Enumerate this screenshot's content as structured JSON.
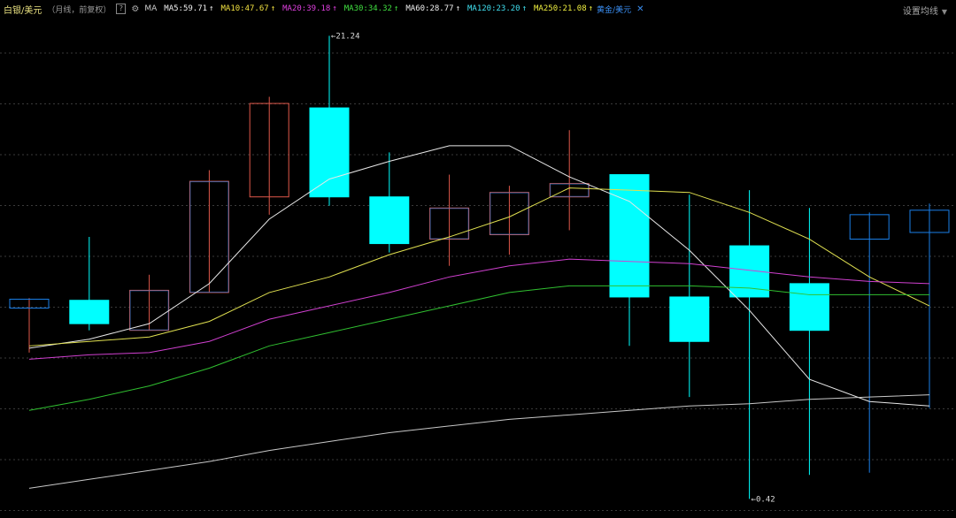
{
  "header": {
    "symbol": "白银/美元",
    "mode": "（月线，前复权）",
    "help": "?",
    "ma_label": "MA",
    "ma": [
      {
        "label": "MA5",
        "value": "59.71",
        "color": "#f0f0f0"
      },
      {
        "label": "MA10",
        "value": "47.67",
        "color": "#f0e040"
      },
      {
        "label": "MA20",
        "value": "39.18",
        "color": "#e040e0"
      },
      {
        "label": "MA30",
        "value": "34.32",
        "color": "#40e040"
      },
      {
        "label": "MA60",
        "value": "28.77",
        "color": "#f0f0f0"
      },
      {
        "label": "MA120",
        "value": "23.20",
        "color": "#40e0f0"
      },
      {
        "label": "MA250",
        "value": "21.08",
        "color": "#f0f040"
      }
    ],
    "compare": "黄金/美元",
    "settings": "设置均线"
  },
  "colors": {
    "up": "#e0584a",
    "down_fill": "#00ffff",
    "down_dark": "#1a7fe8",
    "grid": "#3a3a3a"
  },
  "chart_data": {
    "type": "candlestick",
    "y_axis": "hidden",
    "grid": true,
    "candles": [
      {
        "open": 9.0,
        "close": 9.4,
        "high": 9.45,
        "low": 7.0,
        "style": "up_blue_box"
      },
      {
        "open": 9.35,
        "close": 8.3,
        "high": 12.2,
        "low": 8.0,
        "style": "down"
      },
      {
        "open": 9.8,
        "close": 8.0,
        "high": 10.5,
        "low": 8.0,
        "style": "up_mixed"
      },
      {
        "open": 9.7,
        "close": 14.7,
        "high": 15.2,
        "low": 9.7,
        "style": "up_mixed"
      },
      {
        "open": 14.0,
        "close": 18.2,
        "high": 18.5,
        "low": 13.2,
        "style": "up"
      },
      {
        "open": 18.0,
        "close": 14.0,
        "high": 21.24,
        "low": 13.6,
        "style": "down"
      },
      {
        "open": 14.0,
        "close": 11.9,
        "high": 16.0,
        "low": 11.5,
        "style": "down"
      },
      {
        "open": 13.5,
        "close": 12.1,
        "high": 15.0,
        "low": 10.9,
        "style": "up_mixed"
      },
      {
        "open": 12.3,
        "close": 14.2,
        "high": 14.5,
        "low": 11.4,
        "style": "up_mixed"
      },
      {
        "open": 14.6,
        "close": 14.0,
        "high": 17.0,
        "low": 12.5,
        "style": "up_mixed"
      },
      {
        "open": 15.0,
        "close": 9.5,
        "high": 15.0,
        "low": 7.3,
        "style": "down"
      },
      {
        "open": 9.5,
        "close": 7.5,
        "high": 14.1,
        "low": 5.0,
        "style": "down"
      },
      {
        "open": 11.8,
        "close": 9.5,
        "high": 14.3,
        "low": 0.42,
        "style": "down"
      },
      {
        "open": 10.1,
        "close": 8.0,
        "high": 13.5,
        "low": 1.5,
        "style": "down"
      },
      {
        "open": 13.2,
        "close": 12.1,
        "high": 13.3,
        "low": 1.6,
        "style": "down_hollow"
      },
      {
        "open": 13.4,
        "close": 12.4,
        "high": 13.7,
        "low": 4.5,
        "style": "down_hollow"
      }
    ],
    "series": [
      {
        "name": "MA5",
        "values": [
          7.2,
          7.6,
          8.3,
          10.1,
          13.0,
          14.8,
          15.6,
          16.3,
          16.3,
          14.9,
          13.8,
          11.6,
          8.9,
          5.8,
          4.8,
          4.6
        ]
      },
      {
        "name": "MA10",
        "values": [
          7.3,
          7.5,
          7.7,
          8.4,
          9.7,
          10.4,
          11.4,
          12.2,
          13.1,
          14.4,
          14.3,
          14.2,
          13.3,
          12.1,
          10.4,
          9.1
        ]
      },
      {
        "name": "MA20",
        "values": [
          6.7,
          6.9,
          7.0,
          7.5,
          8.5,
          9.1,
          9.7,
          10.4,
          10.9,
          11.2,
          11.1,
          11.0,
          10.7,
          10.4,
          10.2,
          10.1
        ]
      },
      {
        "name": "MA30",
        "values": [
          4.4,
          4.9,
          5.5,
          6.3,
          7.3,
          7.9,
          8.5,
          9.1,
          9.7,
          10.0,
          10.0,
          10.0,
          9.9,
          9.6,
          9.6,
          9.6
        ]
      },
      {
        "name": "MA60",
        "values": [
          0.9,
          1.3,
          1.7,
          2.1,
          2.6,
          3.0,
          3.4,
          3.7,
          4.0,
          4.2,
          4.4,
          4.6,
          4.7,
          4.9,
          5.0,
          5.1
        ]
      }
    ],
    "annotations": [
      {
        "text": "21.24",
        "candle": 5,
        "value": 21.24
      },
      {
        "text": "0.42",
        "candle": 12,
        "value": 0.42
      }
    ]
  }
}
